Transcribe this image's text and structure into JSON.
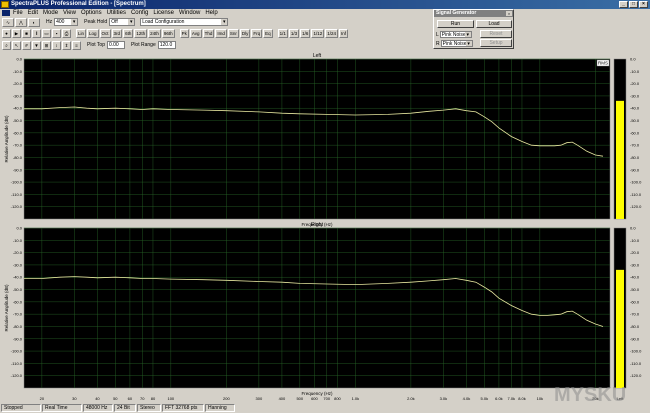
{
  "window": {
    "title": "SpectraPLUS Professional Edition - [Spectrum]"
  },
  "menu": [
    "File",
    "Edit",
    "Mode",
    "View",
    "Options",
    "Utilities",
    "Config",
    "License",
    "Window",
    "Help"
  ],
  "toolbar": {
    "hz_label": "Hz",
    "hz_value": "400",
    "peak_hold_label": "Peak Hold",
    "peak_hold_value": "Off",
    "config_value": "Load Configuration",
    "row2_buttons": [
      "Lin",
      "Log",
      "Oct",
      "3rd",
      "6th",
      "12th",
      "24th",
      "96th",
      "Pk",
      "Avg",
      "Thd",
      "Imd",
      "Snr",
      "Dly",
      "Frq",
      "Eq"
    ],
    "row2_right": [
      "1/1",
      "1/3",
      "1/6",
      "1/12",
      "1/24",
      "Inf"
    ],
    "plot_top_label": "Plot Top",
    "plot_top_value": "0.00",
    "plot_range_label": "Plot Range",
    "plot_range_value": "120.0",
    "row3_buttons": [
      "Zm",
      "Pan",
      "Crs",
      "Mrk",
      "Hd",
      "Lim",
      "Ref",
      "Ovl",
      "Avg",
      "Nrm"
    ]
  },
  "signal_generator": {
    "title": "Signal Generator",
    "run": "Run",
    "load": "Load",
    "l_label": "L",
    "l_value": "Pink Noise",
    "r_label": "R",
    "r_value": "Pink Noise",
    "reset": "Reset",
    "extra": "Setup"
  },
  "plots": [
    {
      "title": "Left",
      "ylabel": "Relative Amplitude (dB)"
    },
    {
      "title": "Right",
      "ylabel": "Relative Amplitude (dB)"
    }
  ],
  "xlabel": "Frequency (Hz)",
  "rms_label": "RMS",
  "meter_labels": [
    "Left",
    "Right"
  ],
  "y_ticks": [
    "0.0",
    "-10.0",
    "-20.0",
    "-30.0",
    "-40.0",
    "-50.0",
    "-60.0",
    "-70.0",
    "-80.0",
    "-90.0",
    "-100.0",
    "-110.0",
    "-120.0"
  ],
  "x_ticks": [
    {
      "f": 20,
      "label": "20"
    },
    {
      "f": 30,
      "label": "30"
    },
    {
      "f": 40,
      "label": "40"
    },
    {
      "f": 50,
      "label": "50"
    },
    {
      "f": 60,
      "label": "60"
    },
    {
      "f": 70,
      "label": "70"
    },
    {
      "f": 80,
      "label": "80"
    },
    {
      "f": 100,
      "label": "100"
    },
    {
      "f": 200,
      "label": "200"
    },
    {
      "f": 300,
      "label": "300"
    },
    {
      "f": 400,
      "label": "400"
    },
    {
      "f": 500,
      "label": "500"
    },
    {
      "f": 600,
      "label": "600"
    },
    {
      "f": 700,
      "label": "700"
    },
    {
      "f": 800,
      "label": "800"
    },
    {
      "f": 1000,
      "label": "1.0k"
    },
    {
      "f": 2000,
      "label": "2.0k"
    },
    {
      "f": 3000,
      "label": "3.0k"
    },
    {
      "f": 4000,
      "label": "4.0k"
    },
    {
      "f": 5000,
      "label": "5.0k"
    },
    {
      "f": 6000,
      "label": "6.0k"
    },
    {
      "f": 7000,
      "label": "7.0k"
    },
    {
      "f": 8000,
      "label": "8.0k"
    },
    {
      "f": 10000,
      "label": "10k"
    },
    {
      "f": 20000,
      "label": "20k"
    }
  ],
  "status": [
    "Stopped",
    "Real Time",
    "48000 Hz",
    "24 Bit",
    "Stereo",
    "FFT 32768 pts",
    "Hanning"
  ],
  "watermark": "MYSKU",
  "colors": {
    "plot_bg": "#000000",
    "trace": "#e8e8a0",
    "grid": "#2a6a2a",
    "meter": "#ffff00"
  },
  "chart_data": [
    {
      "type": "line",
      "title": "Left",
      "xlabel": "Frequency (Hz)",
      "ylabel": "Relative Amplitude (dB)",
      "xscale": "log",
      "xlim": [
        16,
        24000
      ],
      "ylim": [
        -130,
        0
      ],
      "grid": true,
      "meter_level_db": -34,
      "x": [
        16,
        20,
        25,
        30,
        35,
        40,
        50,
        60,
        70,
        80,
        100,
        150,
        200,
        300,
        400,
        500,
        700,
        1000,
        1500,
        2000,
        2500,
        3000,
        3500,
        4000,
        4500,
        5000,
        5500,
        6000,
        7000,
        8000,
        9000,
        10000,
        11000,
        12000,
        13000,
        14000,
        15000,
        16000,
        18000,
        20000,
        22000
      ],
      "y": [
        -40.5,
        -40.5,
        -39.5,
        -39,
        -40,
        -40.5,
        -40,
        -40.5,
        -41,
        -40.5,
        -41,
        -41.5,
        -42,
        -43,
        -44,
        -44.5,
        -45,
        -45.5,
        -45,
        -44,
        -42.5,
        -41.5,
        -40.5,
        -42,
        -43,
        -47,
        -51,
        -56,
        -63,
        -67,
        -70,
        -70.5,
        -70.5,
        -70.5,
        -70,
        -68,
        -67.5,
        -70,
        -75,
        -78,
        -79
      ]
    },
    {
      "type": "line",
      "title": "Right",
      "xlabel": "Frequency (Hz)",
      "ylabel": "Relative Amplitude (dB)",
      "xscale": "log",
      "xlim": [
        16,
        24000
      ],
      "ylim": [
        -130,
        0
      ],
      "grid": true,
      "meter_level_db": -34,
      "x": [
        16,
        20,
        25,
        30,
        35,
        40,
        50,
        60,
        70,
        80,
        100,
        150,
        200,
        300,
        400,
        500,
        700,
        1000,
        1500,
        2000,
        2500,
        3000,
        3500,
        4000,
        4500,
        5000,
        5500,
        6000,
        7000,
        8000,
        9000,
        10000,
        11000,
        12000,
        13000,
        14000,
        15000,
        16000,
        18000,
        20000,
        22000
      ],
      "y": [
        -41,
        -41,
        -40,
        -39.5,
        -40,
        -40.5,
        -40,
        -40.5,
        -41,
        -41,
        -41.5,
        -42,
        -42.5,
        -43.5,
        -44,
        -45,
        -45.5,
        -46,
        -45,
        -44,
        -43,
        -42,
        -41,
        -42.5,
        -44,
        -48,
        -52,
        -57,
        -63,
        -67,
        -70,
        -71,
        -71,
        -70.5,
        -70,
        -68,
        -67.5,
        -70,
        -75,
        -78,
        -80
      ]
    }
  ]
}
